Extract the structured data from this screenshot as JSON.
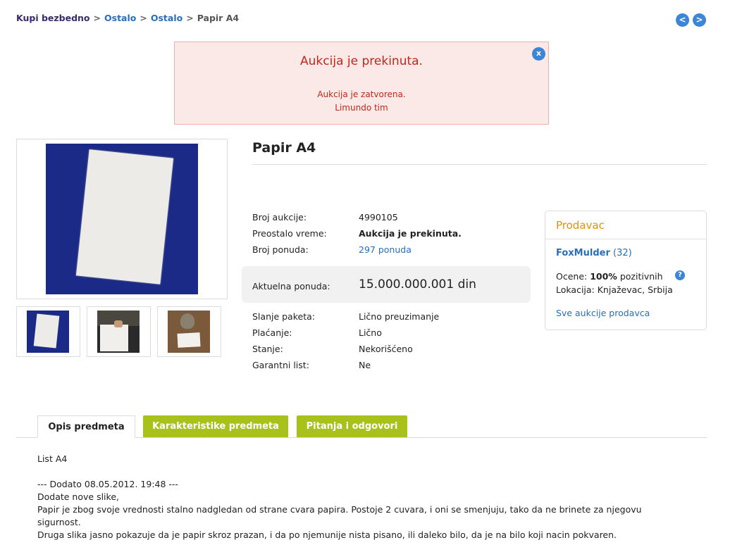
{
  "breadcrumb": {
    "home": "Kupi bezbedno",
    "sep": ">",
    "cat1": "Ostalo",
    "cat2": "Ostalo",
    "current": "Papir A4"
  },
  "nav": {
    "prev": "<",
    "next": ">"
  },
  "alert": {
    "title": "Aukcija je prekinuta.",
    "line1": "Aukcija je zatvorena.",
    "line2": "Limundo tim",
    "close": "x"
  },
  "item": {
    "title": "Papir A4",
    "details": [
      {
        "label": "Broj aukcije:",
        "value": "4990105"
      },
      {
        "label": "Preostalo vreme:",
        "value": "Aukcija je prekinuta."
      },
      {
        "label": "Broj ponuda:",
        "value": "297 ponuda"
      }
    ],
    "price": {
      "label": "Aktuelna ponuda:",
      "value": "15.000.000.001 din"
    },
    "more": [
      {
        "label": "Slanje paketa:",
        "value": "Lično preuzimanje"
      },
      {
        "label": "Plaćanje:",
        "value": "Lično"
      },
      {
        "label": "Stanje:",
        "value": "Nekorišćeno"
      },
      {
        "label": "Garantni list:",
        "value": "Ne"
      }
    ]
  },
  "seller": {
    "heading": "Prodavac",
    "name": "FoxMulder",
    "count": "(32)",
    "ratings_prefix": "Ocene:",
    "ratings_value": "100%",
    "ratings_suffix": "pozitivnih",
    "help": "?",
    "location": "Lokacija: Knjaževac, Srbija",
    "all_auctions": "Sve aukcije prodavca"
  },
  "tabs": [
    {
      "label": "Opis predmeta"
    },
    {
      "label": "Karakteristike predmeta"
    },
    {
      "label": "Pitanja i odgovori"
    }
  ],
  "description": {
    "line1": "List A4",
    "line2": "--- Dodato 08.05.2012. 19:48 ---",
    "line3": "Dodate nove slike,",
    "line4": "Papir je zbog svoje vrednosti stalno nadgledan od strane cvara papira. Postoje 2 cuvara, i oni se smenjuju, tako da ne brinete za njegovu",
    "line5": "sigurnost.",
    "line6": "Druga slika jasno pokazuje da je papir skroz prazan, i da po njemunije nista pisano, ili daleko bilo, da je na bilo koji nacin pokvaren."
  },
  "colors": {
    "link": "#2a6db8",
    "alert_text": "#c0281a",
    "seller_heading": "#e49200",
    "tab_green": "#a9c21b"
  }
}
